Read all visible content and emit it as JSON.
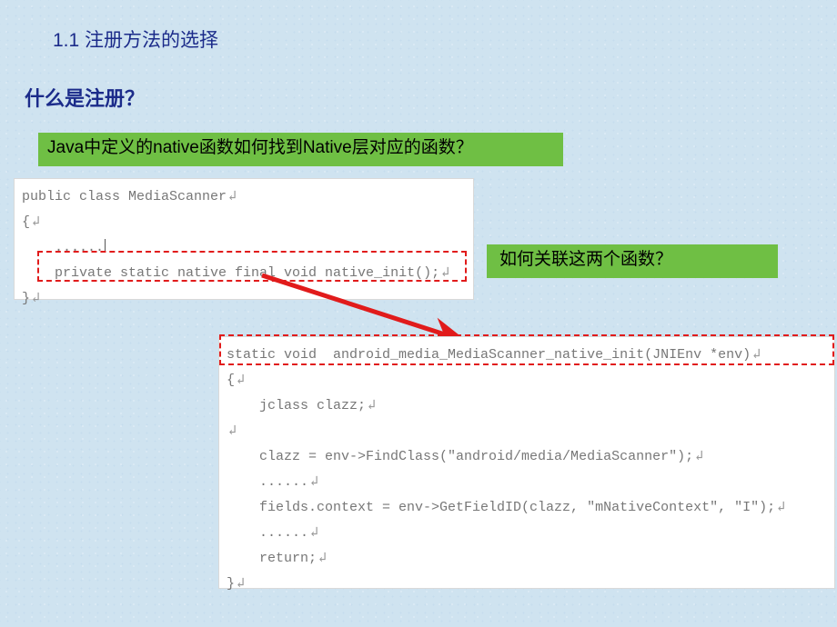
{
  "section_heading": "1.1 注册方法的选择",
  "question_heading": "什么是注册？",
  "green_boxes": {
    "q1": "Java中定义的native函数如何找到Native层对应的函数？",
    "q2": "如何关联这两个函数？"
  },
  "code_block_1": {
    "line1": "public class MediaScanner",
    "line2": "{",
    "line3": "    ......",
    "line4": "    private static native final void native_init();",
    "line5": "}"
  },
  "code_block_2": {
    "line1": "static void  android_media_MediaScanner_native_init(JNIEnv *env)",
    "line2": "{",
    "line3": "    jclass clazz;",
    "line4": "",
    "line5": "    clazz = env->FindClass(\"android/media/MediaScanner\");",
    "line6": "    ......",
    "line7": "    fields.context = env->GetFieldID(clazz, \"mNativeContext\", \"I\");",
    "line8": "    ......",
    "line9": "    return;",
    "line10": "}"
  }
}
